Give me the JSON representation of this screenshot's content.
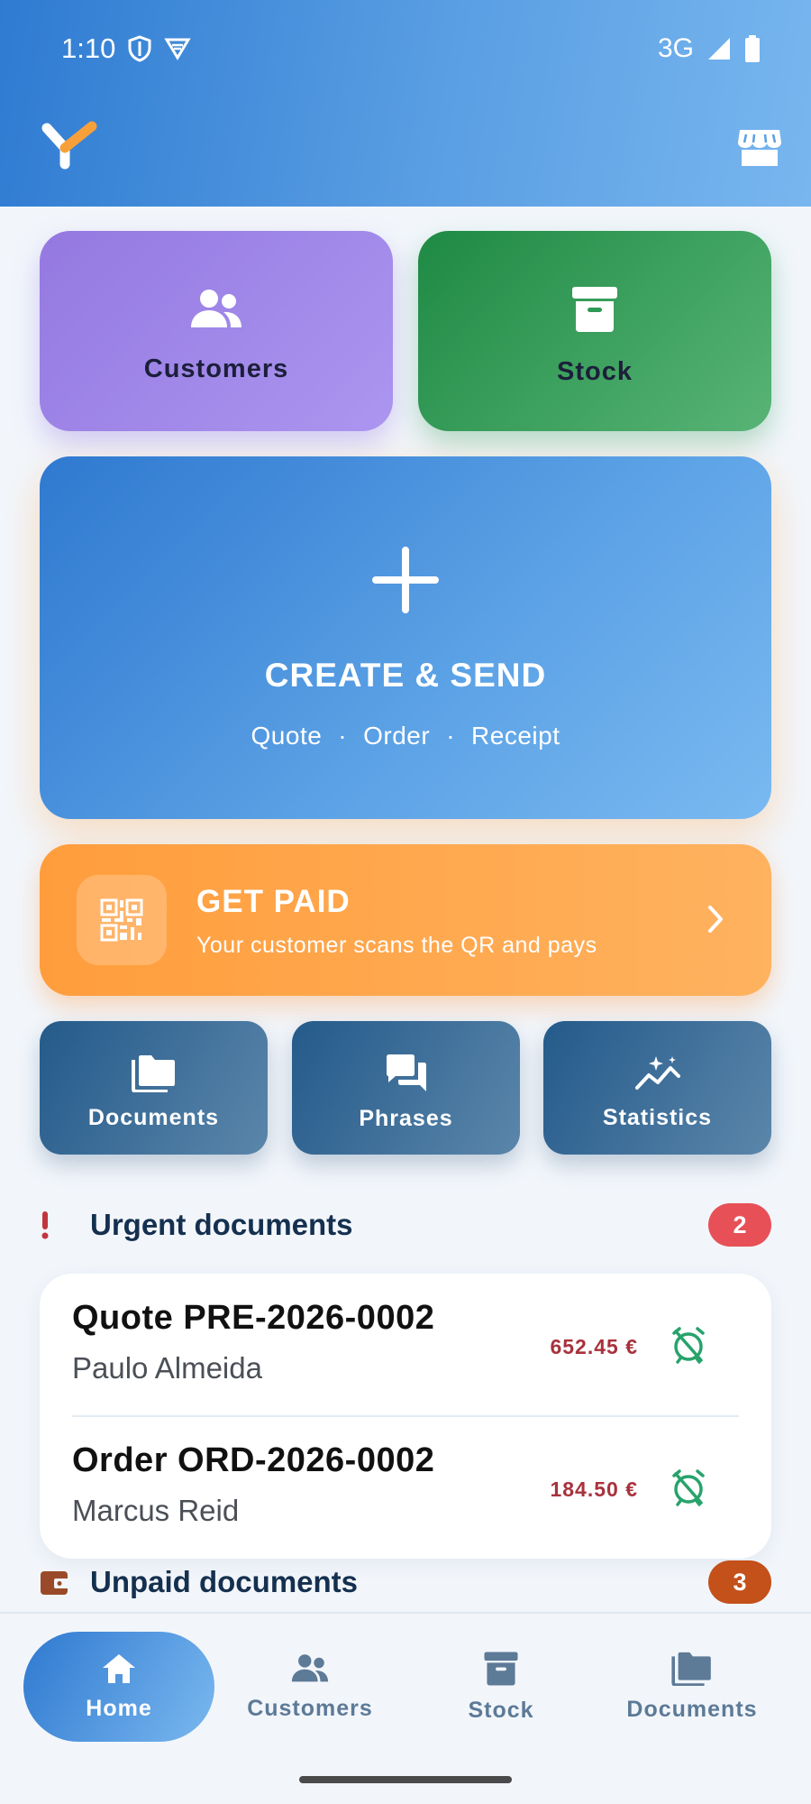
{
  "status_bar": {
    "time": "1:10",
    "network": "3G"
  },
  "header": {
    "logo_icon": "app-logo-y",
    "store_icon": "store-icon"
  },
  "tiles": {
    "customers": {
      "label": "Customers",
      "icon": "users-icon",
      "color": "#9b82e8"
    },
    "stock": {
      "label": "Stock",
      "icon": "archive-box-icon",
      "color": "#2e9a55"
    }
  },
  "create": {
    "title": "CREATE & SEND",
    "types": [
      "Quote",
      "Order",
      "Receipt"
    ],
    "separator": "·"
  },
  "get_paid": {
    "title": "GET PAID",
    "subtitle": "Your customer scans the QR and pays",
    "icon": "qr-code-icon"
  },
  "nav_tiles": {
    "documents": {
      "label": "Documents",
      "icon": "folder-icon"
    },
    "phrases": {
      "label": "Phrases",
      "icon": "chat-bubbles-icon"
    },
    "statistics": {
      "label": "Statistics",
      "icon": "sparkle-chart-icon"
    }
  },
  "urgent": {
    "title": "Urgent documents",
    "count": "2",
    "badge_color": "#e65056",
    "items": [
      {
        "title": "Quote PRE-2026-0002",
        "client": "Paulo Almeida",
        "amount": "652.45 €"
      },
      {
        "title": "Order ORD-2026-0002",
        "client": "Marcus Reid",
        "amount": "184.50 €"
      }
    ]
  },
  "unpaid": {
    "title": "Unpaid documents",
    "count": "3",
    "badge_color": "#c4501a"
  },
  "bottom_nav": [
    {
      "label": "Home",
      "icon": "home-icon",
      "active": true
    },
    {
      "label": "Customers",
      "icon": "users-icon",
      "active": false
    },
    {
      "label": "Stock",
      "icon": "archive-box-icon",
      "active": false
    },
    {
      "label": "Documents",
      "icon": "folder-icon",
      "active": false
    }
  ]
}
